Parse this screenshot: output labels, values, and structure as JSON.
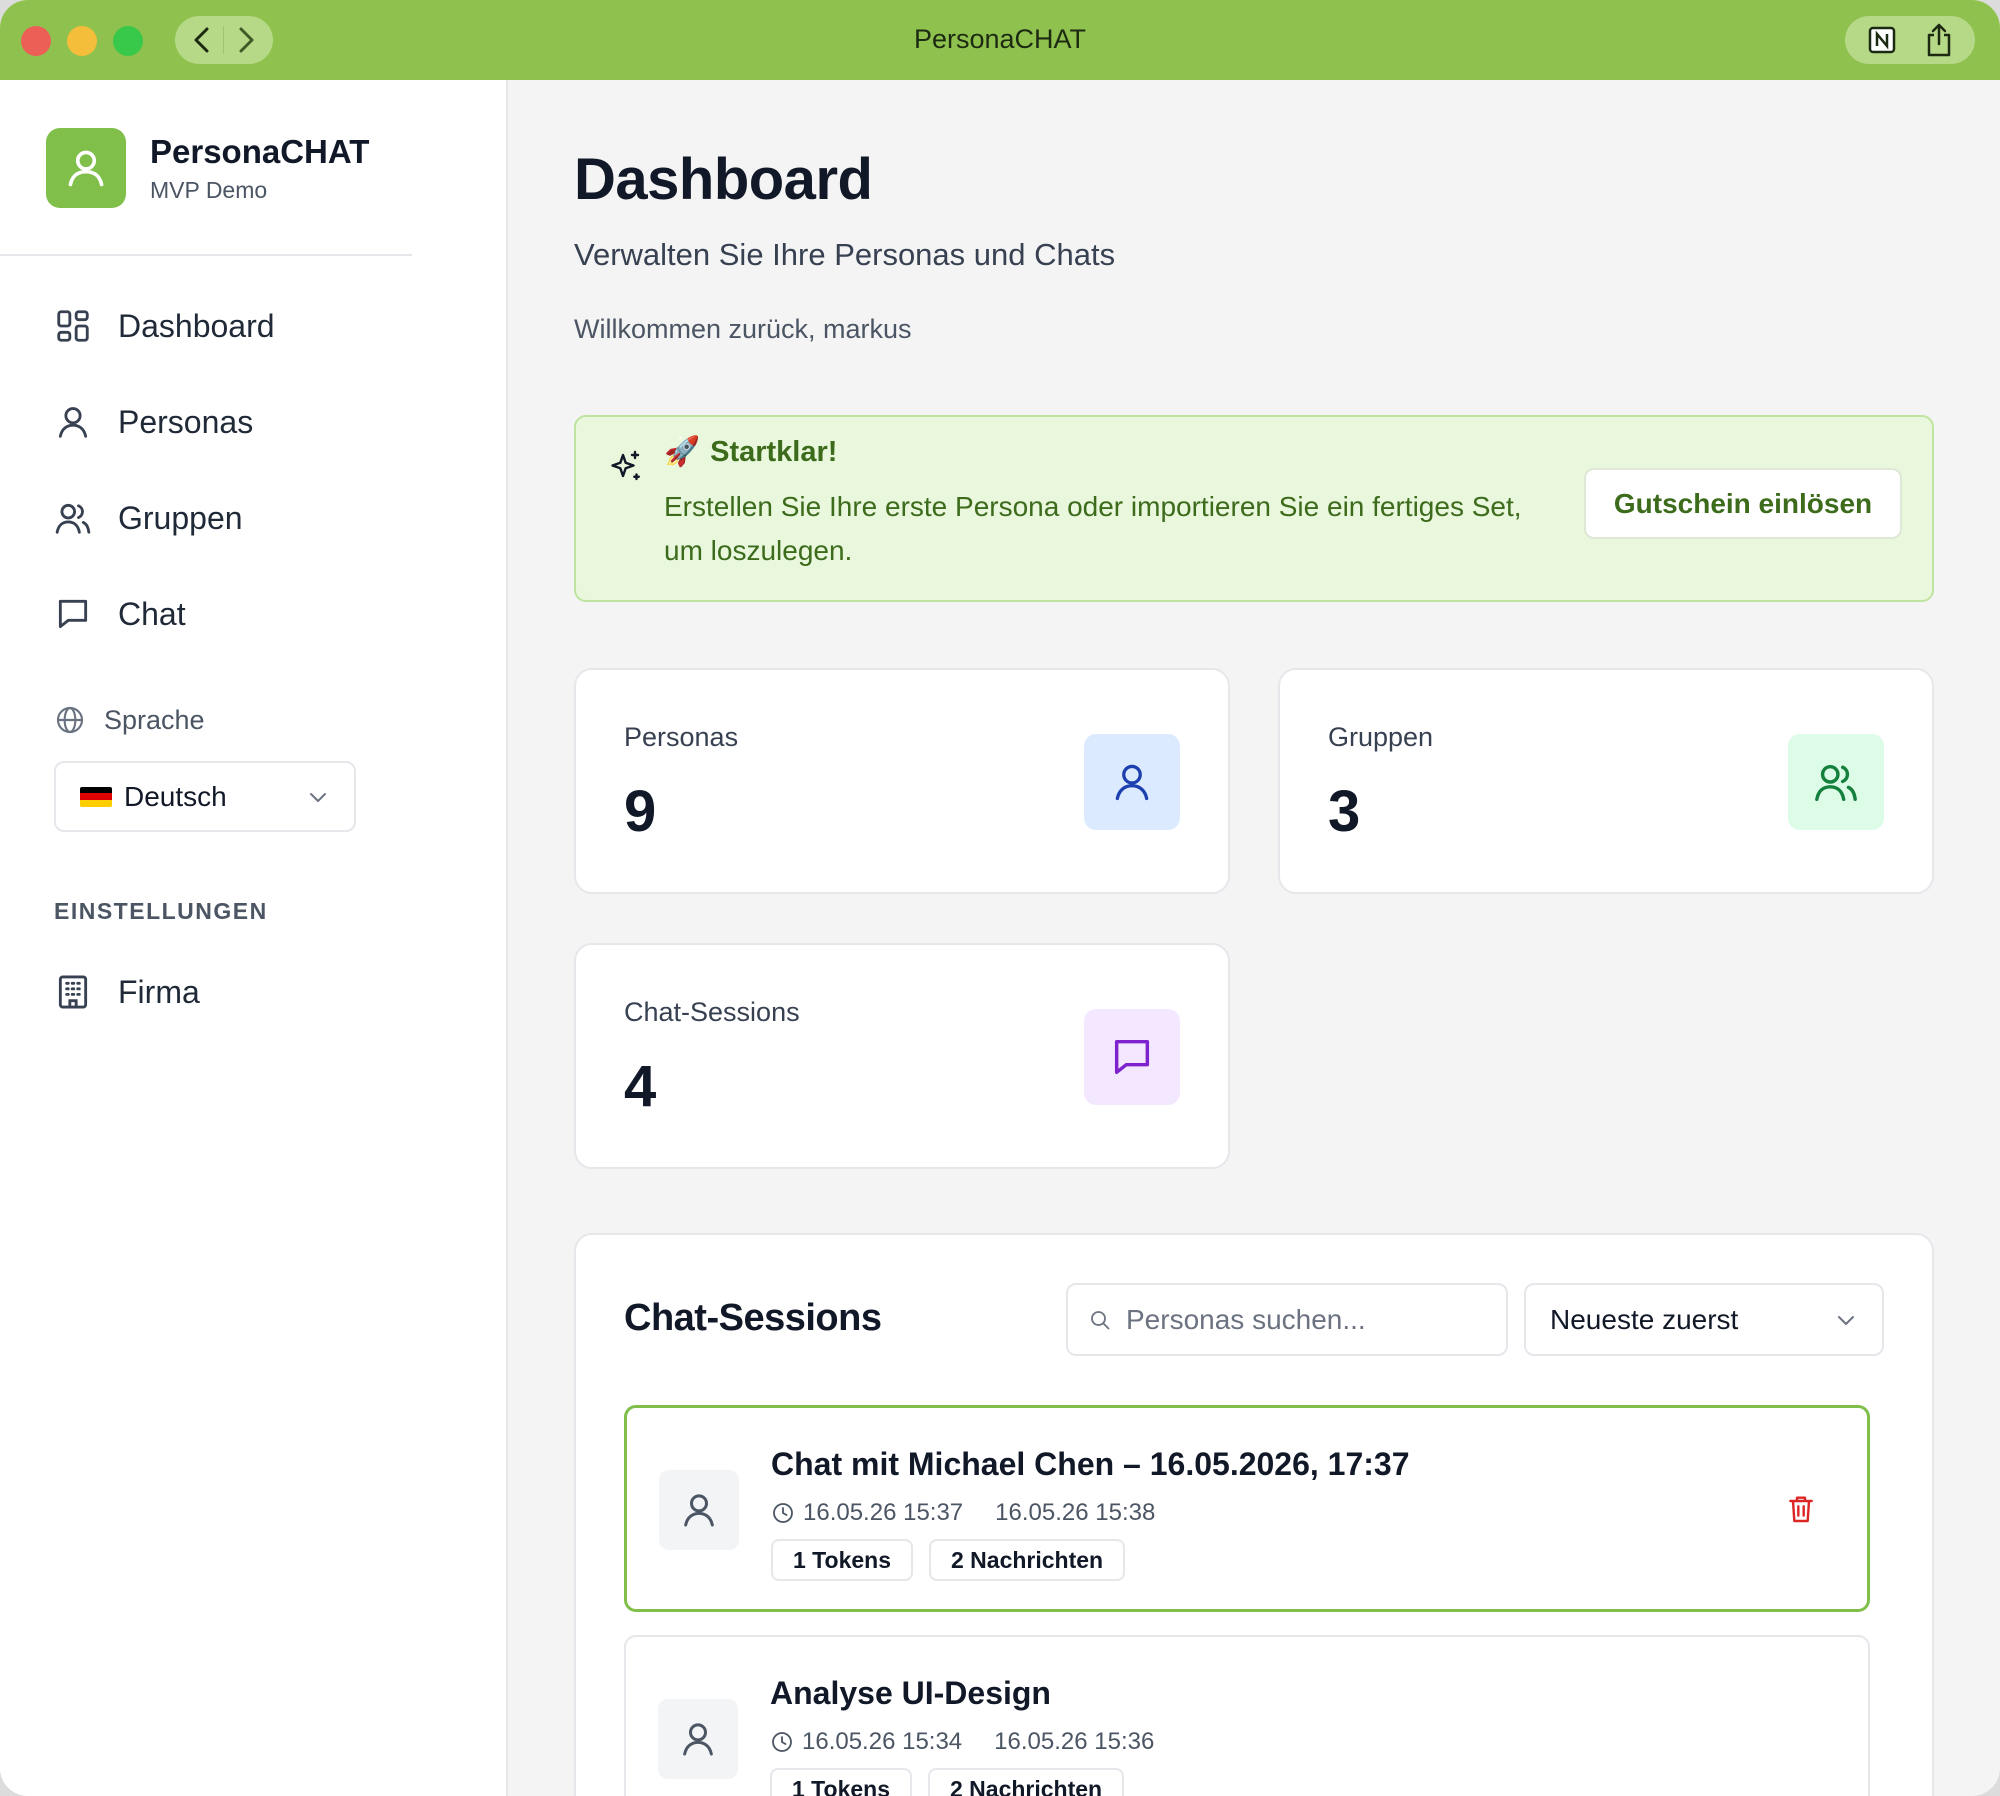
{
  "window": {
    "title": "PersonaCHAT"
  },
  "brand": {
    "name": "PersonaCHAT",
    "subtitle": "MVP Demo"
  },
  "nav": {
    "dashboard": "Dashboard",
    "personas": "Personas",
    "gruppen": "Gruppen",
    "chat": "Chat"
  },
  "language": {
    "label": "Sprache",
    "selected": "Deutsch"
  },
  "settings": {
    "heading": "EINSTELLUNGEN",
    "firma": "Firma"
  },
  "page": {
    "title": "Dashboard",
    "subtitle": "Verwalten Sie Ihre Personas und Chats",
    "welcome": "Willkommen zurück, markus"
  },
  "banner": {
    "emoji": "🚀",
    "title": "Startklar!",
    "text": "Erstellen Sie Ihre erste Persona oder importieren Sie ein fertiges Set, um loszulegen.",
    "button": "Gutschein einlösen"
  },
  "stats": [
    {
      "label": "Personas",
      "value": "9"
    },
    {
      "label": "Gruppen",
      "value": "3"
    },
    {
      "label": "Chat-Sessions",
      "value": "4"
    }
  ],
  "sessions": {
    "title": "Chat-Sessions",
    "search_placeholder": "Personas suchen...",
    "sort": "Neueste zuerst",
    "items": [
      {
        "title": "Chat mit Michael Chen – 16.05.2026, 17:37",
        "created": "16.05.26 15:37",
        "updated": "16.05.26 15:38",
        "tokens": "1 Tokens",
        "messages": "2 Nachrichten"
      },
      {
        "title": "Analyse UI-Design",
        "created": "16.05.26 15:34",
        "updated": "16.05.26 15:36",
        "tokens": "1 Tokens",
        "messages": "2 Nachrichten"
      }
    ]
  },
  "colors": {
    "titlebar": "#8fc14e",
    "brand_green": "#7fbf4a",
    "banner_bg": "#e9f7dc",
    "banner_text": "#3d6b1c",
    "persona_icon_bg": "#dbeafe",
    "group_icon_bg": "#dcfce7",
    "chat_icon_bg": "#f3e8ff",
    "danger": "#dc2626"
  }
}
